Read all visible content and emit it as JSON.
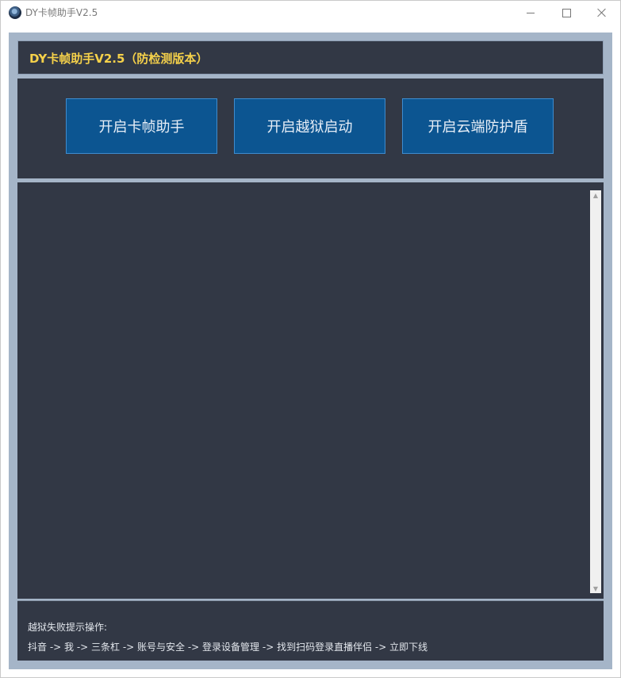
{
  "window": {
    "title": "DY卡帧助手V2.5",
    "icon": "app-eye-icon"
  },
  "header": {
    "heading": "DY卡帧助手V2.5（防检测版本）",
    "heading_color": "#f5d14a"
  },
  "actions": [
    {
      "label": "开启卡帧助手"
    },
    {
      "label": "开启越狱启动"
    },
    {
      "label": "开启云端防护盾"
    }
  ],
  "log": {
    "content": ""
  },
  "footer": {
    "hint_title": "越狱失败提示操作:",
    "hint_path": "抖音 -> 我 -> 三条杠 -> 账号与安全 -> 登录设备管理 -> 找到扫码登录直播伴侣 -> 立即下线"
  },
  "colors": {
    "panel_bg": "#323845",
    "button_bg": "#0c5591",
    "frame_bg": "#a5b5c8"
  }
}
